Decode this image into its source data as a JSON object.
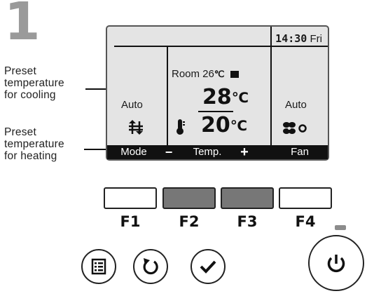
{
  "step_number": "1",
  "annotations": {
    "cooling": [
      "Preset",
      "temperature",
      "for cooling"
    ],
    "heating": [
      "Preset",
      "temperature",
      "for heating"
    ]
  },
  "display": {
    "time": "14:30",
    "day": "Fri",
    "room_label": "Room 26",
    "room_unit": "℃",
    "left_mode": "Auto",
    "right_fan": "Auto",
    "cool_setpoint": "28",
    "heat_setpoint": "20",
    "setpoint_unit": "℃",
    "softkeys": {
      "mode": "Mode",
      "minus": "−",
      "temp": "Temp.",
      "plus": "+",
      "fan": "Fan"
    }
  },
  "function_buttons": [
    {
      "label": "F1",
      "color": "#ffffff"
    },
    {
      "label": "F2",
      "color": "#777777"
    },
    {
      "label": "F3",
      "color": "#777777"
    },
    {
      "label": "F4",
      "color": "#ffffff"
    }
  ],
  "icons": {
    "menu": "menu-icon",
    "back": "return-icon",
    "confirm": "check-icon",
    "power": "power-icon",
    "mode": "auto-mode-icon",
    "fan": "fan-icon",
    "thermo": "thermometer-icon"
  },
  "colors": {
    "lcd_bg": "#e4e4e4",
    "lcd_bar": "#111111",
    "step_number": "#9a9a9a",
    "led": "#8c8c8c"
  }
}
